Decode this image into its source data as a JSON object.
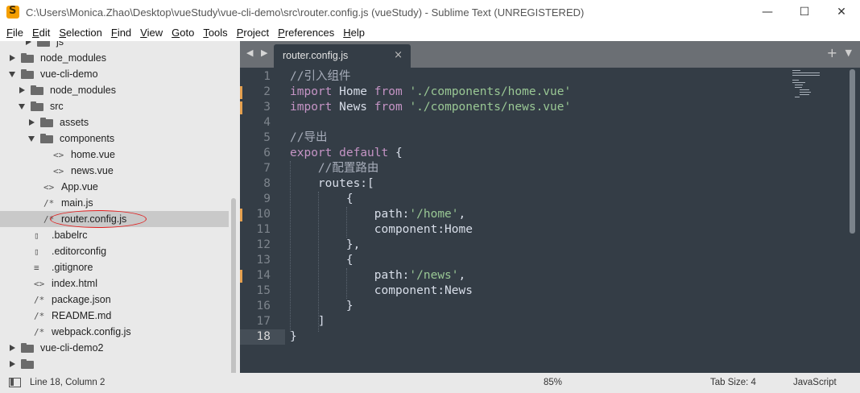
{
  "window": {
    "title": "C:\\Users\\Monica.Zhao\\Desktop\\vueStudy\\vue-cli-demo\\src\\router.config.js (vueStudy) - Sublime Text (UNREGISTERED)",
    "minimize": "—",
    "maximize": "☐",
    "close": "✕"
  },
  "menu": [
    "File",
    "Edit",
    "Selection",
    "Find",
    "View",
    "Goto",
    "Tools",
    "Project",
    "Preferences",
    "Help"
  ],
  "sidebar": {
    "items": [
      {
        "label": "js",
        "kind": "folder",
        "open": false
      },
      {
        "label": "node_modules",
        "kind": "folder",
        "open": false
      },
      {
        "label": "vue-cli-demo",
        "kind": "folder",
        "open": true
      },
      {
        "label": "node_modules",
        "kind": "folder",
        "open": false
      },
      {
        "label": "src",
        "kind": "folder",
        "open": true
      },
      {
        "label": "assets",
        "kind": "folder",
        "open": false
      },
      {
        "label": "components",
        "kind": "folder",
        "open": true
      },
      {
        "label": "home.vue",
        "kind": "file",
        "glyph": "<>"
      },
      {
        "label": "news.vue",
        "kind": "file",
        "glyph": "<>"
      },
      {
        "label": "App.vue",
        "kind": "file",
        "glyph": "<>"
      },
      {
        "label": "main.js",
        "kind": "file",
        "glyph": "/*"
      },
      {
        "label": "router.config.js",
        "kind": "file",
        "glyph": "/*"
      },
      {
        "label": ".babelrc",
        "kind": "file",
        "glyph": "doc"
      },
      {
        "label": ".editorconfig",
        "kind": "file",
        "glyph": "doc"
      },
      {
        "label": ".gitignore",
        "kind": "file",
        "glyph": "≡"
      },
      {
        "label": "index.html",
        "kind": "file",
        "glyph": "<>"
      },
      {
        "label": "package.json",
        "kind": "file",
        "glyph": "/*"
      },
      {
        "label": "README.md",
        "kind": "file",
        "glyph": "/*"
      },
      {
        "label": "webpack.config.js",
        "kind": "file",
        "glyph": "/*"
      },
      {
        "label": "vue-cli-demo2",
        "kind": "folder",
        "open": false
      },
      {
        "label": "",
        "kind": "folder",
        "open": false
      }
    ],
    "selected_index": 11
  },
  "tabbar": {
    "nav": "◀ ▶",
    "active_tab": "router.config.js",
    "close_glyph": "×",
    "plus_glyph": "+",
    "menu_glyph": "▼"
  },
  "editor": {
    "current_line": 18,
    "lines": [
      {
        "n": "1",
        "tokens": [
          [
            "c-comment",
            "//引入组件"
          ]
        ]
      },
      {
        "n": "2",
        "mod": true,
        "tokens": [
          [
            "c-kw",
            "import"
          ],
          [
            "c-plain",
            " Home "
          ],
          [
            "c-kw",
            "from"
          ],
          [
            "c-plain",
            " "
          ],
          [
            "c-str",
            "'./components/home.vue'"
          ]
        ]
      },
      {
        "n": "3",
        "mod": true,
        "tokens": [
          [
            "c-kw",
            "import"
          ],
          [
            "c-plain",
            " News "
          ],
          [
            "c-kw",
            "from"
          ],
          [
            "c-plain",
            " "
          ],
          [
            "c-str",
            "'./components/news.vue'"
          ]
        ]
      },
      {
        "n": "4",
        "tokens": []
      },
      {
        "n": "5",
        "tokens": [
          [
            "c-comment",
            "//导出"
          ]
        ]
      },
      {
        "n": "6",
        "tokens": [
          [
            "c-kw",
            "export"
          ],
          [
            "c-plain",
            " "
          ],
          [
            "c-kw",
            "default"
          ],
          [
            "c-plain",
            " {"
          ]
        ]
      },
      {
        "n": "7",
        "tokens": [
          [
            "c-plain",
            "    "
          ],
          [
            "c-comment",
            "//配置路由"
          ]
        ]
      },
      {
        "n": "8",
        "tokens": [
          [
            "c-plain",
            "    routes:["
          ]
        ]
      },
      {
        "n": "9",
        "tokens": [
          [
            "c-plain",
            "        {"
          ]
        ]
      },
      {
        "n": "10",
        "mod": true,
        "tokens": [
          [
            "c-plain",
            "            path:"
          ],
          [
            "c-str",
            "'/home'"
          ],
          [
            "c-plain",
            ","
          ]
        ]
      },
      {
        "n": "11",
        "tokens": [
          [
            "c-plain",
            "            component:Home"
          ]
        ]
      },
      {
        "n": "12",
        "tokens": [
          [
            "c-plain",
            "        },"
          ]
        ]
      },
      {
        "n": "13",
        "tokens": [
          [
            "c-plain",
            "        {"
          ]
        ]
      },
      {
        "n": "14",
        "mod": true,
        "tokens": [
          [
            "c-plain",
            "            path:"
          ],
          [
            "c-str",
            "'/news'"
          ],
          [
            "c-plain",
            ","
          ]
        ]
      },
      {
        "n": "15",
        "tokens": [
          [
            "c-plain",
            "            component:News"
          ]
        ]
      },
      {
        "n": "16",
        "tokens": [
          [
            "c-plain",
            "        }"
          ]
        ]
      },
      {
        "n": "17",
        "tokens": [
          [
            "c-plain",
            "    ]"
          ]
        ]
      },
      {
        "n": "18",
        "tokens": [
          [
            "c-plain",
            "}"
          ]
        ]
      }
    ]
  },
  "status": {
    "position": "Line 18, Column 2",
    "zoom": "85%",
    "tab_size": "Tab Size: 4",
    "syntax": "JavaScript"
  },
  "colors": {
    "editor_bg": "#343d46",
    "keyword": "#c594c5",
    "string": "#99c794",
    "comment": "#a7adba",
    "modified_marker": "#e5a04f",
    "annotation_oval": "#e02020"
  }
}
